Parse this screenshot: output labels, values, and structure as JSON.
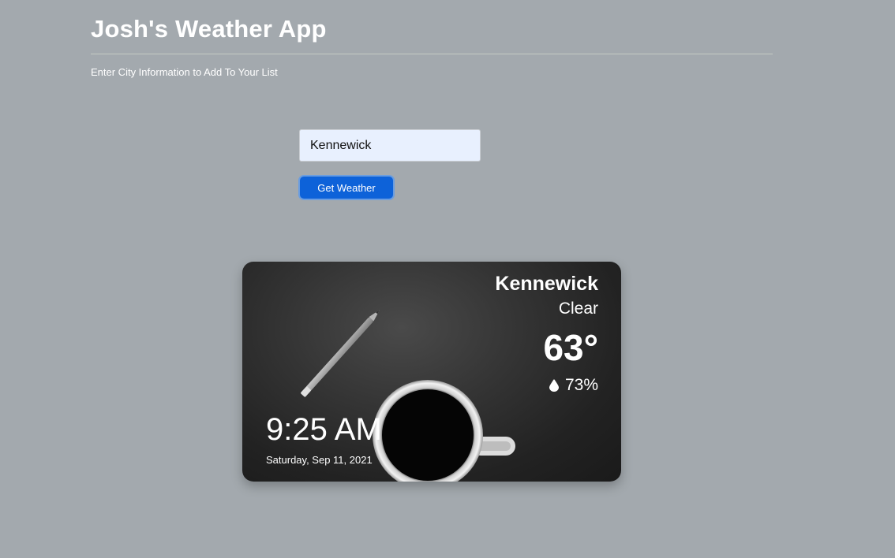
{
  "header": {
    "title": "Josh's Weather App",
    "subtitle": "Enter City Information to Add To Your List"
  },
  "form": {
    "city_value": "Kennewick",
    "button_label": "Get Weather"
  },
  "weather_card": {
    "city": "Kennewick",
    "condition": "Clear",
    "temperature": "63°",
    "humidity": "73%",
    "humidity_icon": "water-drop-icon",
    "time": "9:25 AM",
    "date": "Saturday, Sep 11, 2021",
    "background_image": "coffee-cup-and-pencil-photo"
  },
  "colors": {
    "page_background": "#a3a9ae",
    "button_background": "#0d62d9",
    "input_background": "#e8f0fe"
  }
}
